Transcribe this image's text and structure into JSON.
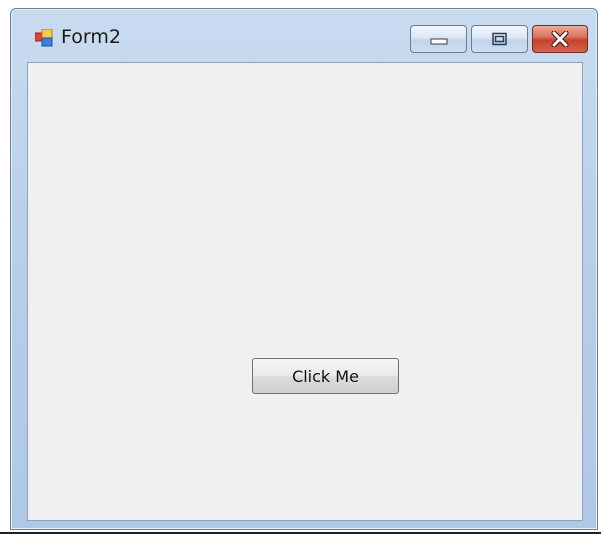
{
  "window": {
    "title": "Form2",
    "icon": "form-app-icon",
    "controls": {
      "minimize_icon": "minimize-icon",
      "maximize_icon": "maximize-icon",
      "close_icon": "close-icon"
    }
  },
  "form": {
    "button_label": "Click Me"
  },
  "colors": {
    "client_background": "#f0f0f0",
    "title_bar": "#b8cfe9",
    "close_button": "#c4432f"
  }
}
